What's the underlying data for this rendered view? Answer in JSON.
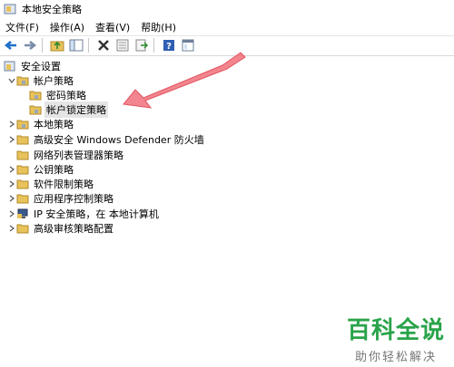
{
  "window": {
    "title": "本地安全策略"
  },
  "menu": [
    "文件(F)",
    "操作(A)",
    "查看(V)",
    "帮助(H)"
  ],
  "toolbar": {
    "buttons": [
      "back-arrow-icon",
      "forward-arrow-icon",
      "up-folder-icon",
      "show-hide-tree-icon",
      "delete-icon",
      "properties-icon",
      "export-list-icon",
      "help-icon",
      "console-icon"
    ]
  },
  "tree": {
    "root": "安全设置",
    "items": [
      {
        "label": "帐户策略",
        "expanded": true
      },
      {
        "label": "密码策略"
      },
      {
        "label": "帐户锁定策略",
        "selected": true
      },
      {
        "label": "本地策略"
      },
      {
        "label": "高级安全 Windows Defender 防火墙"
      },
      {
        "label": "网络列表管理器策略"
      },
      {
        "label": "公钥策略"
      },
      {
        "label": "软件限制策略"
      },
      {
        "label": "应用程序控制策略"
      },
      {
        "label": "IP 安全策略，在 本地计算机"
      },
      {
        "label": "高级审核策略配置"
      }
    ]
  },
  "watermark": {
    "title": "百科全说",
    "subtitle": "助你轻松解决"
  },
  "colors": {
    "arrow": "#f0707a",
    "watermark_green": "#2aa34a",
    "folder": "#e8c25a"
  }
}
